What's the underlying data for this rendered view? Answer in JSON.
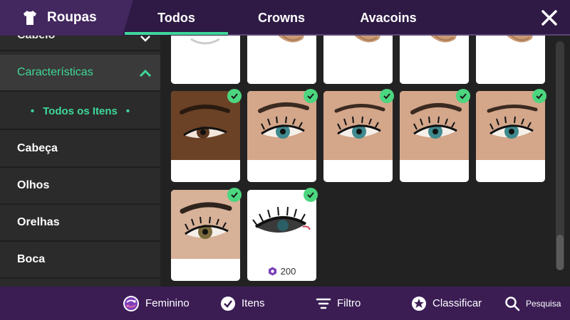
{
  "header": {
    "title": "Roupas",
    "tabs": [
      {
        "label": "Todos",
        "active": true
      },
      {
        "label": "Crowns",
        "active": false
      },
      {
        "label": "Avacoins",
        "active": false
      }
    ]
  },
  "sidebar": {
    "partial_item": "Cabelo",
    "category": "Características",
    "selected_sub": "Todos os Itens",
    "items": [
      "Cabeça",
      "Olhos",
      "Orelhas",
      "Boca"
    ]
  },
  "grid": {
    "items": [
      {
        "type": "ear",
        "owned": false
      },
      {
        "type": "ear",
        "owned": false
      },
      {
        "type": "ear",
        "owned": false
      },
      {
        "type": "ear",
        "owned": false
      },
      {
        "type": "ear",
        "owned": false
      },
      {
        "type": "eye-dark-skin",
        "owned": true
      },
      {
        "type": "eye-teal",
        "owned": true
      },
      {
        "type": "eye-teal",
        "owned": true
      },
      {
        "type": "eye-teal",
        "owned": true
      },
      {
        "type": "eye-teal",
        "owned": true
      },
      {
        "type": "eye-hazel",
        "owned": true
      },
      {
        "type": "eye-lashes",
        "owned": true,
        "price": "200"
      }
    ]
  },
  "bottom": {
    "gender": "Feminino",
    "items": "Itens",
    "filter": "Filtro",
    "sort": "Classificar",
    "search": "Pesquisa"
  },
  "colors": {
    "accent": "#3fd89a",
    "topbar": "#2e1a45",
    "bottombar": "#3b1d54",
    "check": "#4cd67f"
  }
}
